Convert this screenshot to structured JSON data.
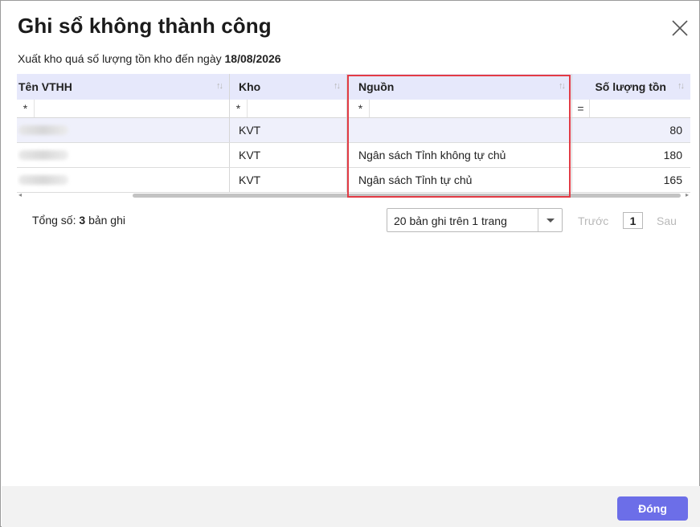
{
  "dialog": {
    "title": "Ghi sổ không thành công",
    "subtitle_prefix": "Xuất kho quá số lượng tồn kho đến ngày",
    "subtitle_date": "18/08/2026"
  },
  "table": {
    "columns": [
      {
        "label": "Tên VTHH",
        "filter_op": "*"
      },
      {
        "label": "Kho",
        "filter_op": "*"
      },
      {
        "label": "Nguồn",
        "filter_op": "*"
      },
      {
        "label": "Số lượng tồn",
        "filter_op": "="
      }
    ],
    "rows": [
      {
        "name": "",
        "kho": "KVT",
        "nguon": "",
        "so_luong": "80"
      },
      {
        "name": "",
        "kho": "KVT",
        "nguon": "Ngân sách Tỉnh không tự chủ",
        "so_luong": "180"
      },
      {
        "name": "",
        "kho": "KVT",
        "nguon": "Ngân sách Tỉnh tự chủ",
        "so_luong": "165"
      }
    ],
    "highlight_color": "#e23b45"
  },
  "pagination": {
    "total_prefix": "Tổng số:",
    "total_count": "3",
    "total_suffix": "bản ghi",
    "page_size": "20 bản ghi trên 1 trang",
    "prev_label": "Trước",
    "current_page": "1",
    "next_label": "Sau"
  },
  "footer": {
    "close_label": "Đóng",
    "accent": "#6c6ee8"
  },
  "icons": {
    "close": "close-icon",
    "sort": "sort-icon",
    "dropdown": "chevron-down-icon"
  }
}
